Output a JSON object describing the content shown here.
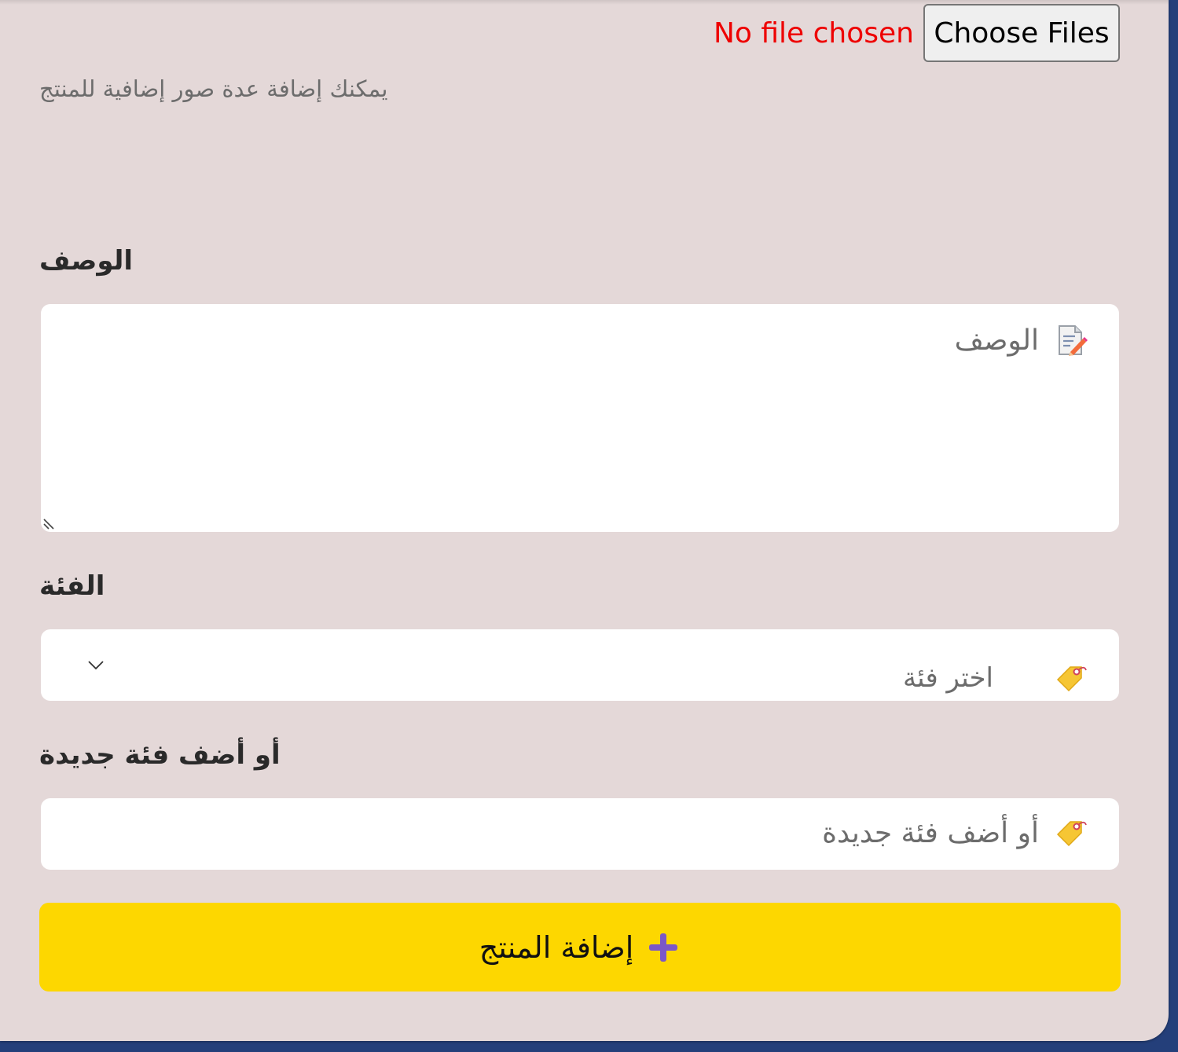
{
  "file_upload": {
    "button_label": "Choose Files",
    "status": "No file chosen",
    "hint": "يمكنك إضافة عدة صور إضافية للمنتج"
  },
  "description": {
    "label": "الوصف",
    "placeholder": "الوصف",
    "icon": "memo-pencil-icon"
  },
  "category": {
    "label": "الفئة",
    "selected": "اختر فئة",
    "icon": "label-tag-icon"
  },
  "new_category": {
    "label": "أو أضف فئة جديدة",
    "placeholder": "أو أضف فئة جديدة",
    "icon": "label-tag-icon"
  },
  "submit": {
    "label": "إضافة المنتج",
    "icon": "plus-icon",
    "color": "#fdd700",
    "icon_color": "#7b57c8"
  },
  "colors": {
    "panel_bg": "#e4d8d8",
    "page_bg": "#243f7a",
    "status_red": "#ee0000"
  }
}
